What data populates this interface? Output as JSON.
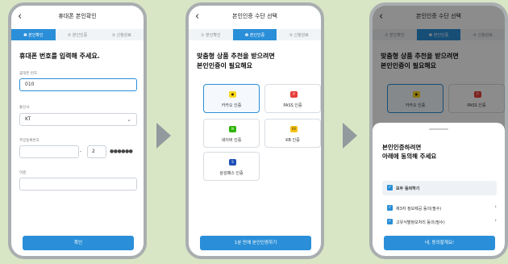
{
  "colors": {
    "accent": "#2a8fd8",
    "background": "#d8e6c5"
  },
  "icons": {
    "back": "chevron-left-icon",
    "arrow": "arrow-right-icon"
  },
  "step_labels": [
    "❶ 본인확인",
    "② 본인인증",
    "③ 신청완료"
  ],
  "step_labels_2": [
    "① 본인확인",
    "❷ 본인인증",
    "③ 신청완료"
  ],
  "screen1": {
    "title": "휴대폰 본인확인",
    "heading": "휴대폰 번호를 입력해 주세요.",
    "phone_label": "휴대폰 번호",
    "phone_value": "010",
    "carrier_label": "통신사",
    "carrier_value": "KT",
    "rrn_label": "주민등록번호",
    "rrn_back_first": "2",
    "rrn_mask": "●●●●●●",
    "name_label": "이름",
    "confirm_button": "확인"
  },
  "screen2": {
    "title": "본인인증 수단 선택",
    "heading_line1": "맞춤형 상품 추천을 받으려면",
    "heading_line2": "본인인증이 필요해요",
    "methods": [
      "카카오 인증",
      "PASS 인증",
      "네이버 인증",
      "KB 인증",
      "삼성패스 인증"
    ],
    "cta": "1분 만에 본인인증하기"
  },
  "screen3": {
    "title": "본인인증 수단 선택",
    "heading_line1": "맞춤형 상품 추천을 받으려면",
    "heading_line2": "본인인증이 필요해요",
    "method_kakao": "카카오 인증",
    "method_pass": "PASS 인증",
    "sheet_line1": "본인인증하려면",
    "sheet_line2": "아래에 동의해 주세요",
    "agree_all": "모두 동의하기",
    "agree_1": "제3자 정보제공 동의(필수)",
    "agree_2": "고유식별정보처리 동의(필수)",
    "agree_button": "네, 동의할게요!"
  }
}
